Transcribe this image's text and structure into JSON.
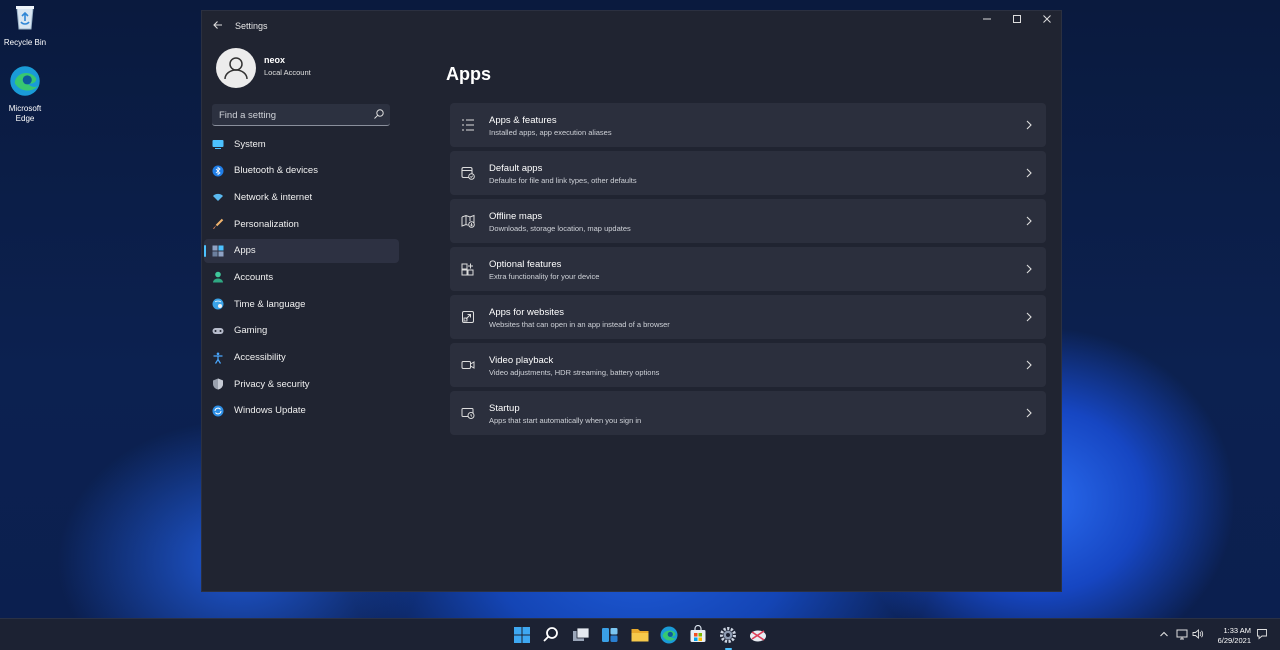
{
  "desktop": {
    "icons": [
      {
        "label": "Recycle Bin",
        "icon": "recycle-bin-icon"
      },
      {
        "label": "Microsoft Edge",
        "icon": "edge-icon"
      }
    ]
  },
  "window": {
    "title": "Settings",
    "controls": {
      "minimize": "minimize-icon",
      "maximize": "maximize-icon",
      "close": "close-icon"
    }
  },
  "profile": {
    "name": "neox",
    "account_type": "Local Account"
  },
  "search": {
    "placeholder": "Find a setting",
    "value": ""
  },
  "nav": {
    "items": [
      {
        "label": "System",
        "icon": "system-icon",
        "color": "#4cc2ff"
      },
      {
        "label": "Bluetooth & devices",
        "icon": "bluetooth-icon",
        "color": "#1f7ee8"
      },
      {
        "label": "Network & internet",
        "icon": "wifi-icon",
        "color": "#5ab9f0"
      },
      {
        "label": "Personalization",
        "icon": "brush-icon",
        "color": "#e6a35c"
      },
      {
        "label": "Apps",
        "icon": "apps-icon",
        "color": "#8fa2c4",
        "active": true
      },
      {
        "label": "Accounts",
        "icon": "accounts-icon",
        "color": "#3fc79b"
      },
      {
        "label": "Time & language",
        "icon": "time-language-icon",
        "color": "#3aa3e8"
      },
      {
        "label": "Gaming",
        "icon": "gaming-icon",
        "color": "#b7bccb"
      },
      {
        "label": "Accessibility",
        "icon": "accessibility-icon",
        "color": "#4aa8ff"
      },
      {
        "label": "Privacy & security",
        "icon": "shield-icon",
        "color": "#9aa1ae"
      },
      {
        "label": "Windows Update",
        "icon": "update-icon",
        "color": "#2d8fe6"
      }
    ]
  },
  "page": {
    "title": "Apps"
  },
  "cards": [
    {
      "title": "Apps & features",
      "subtitle": "Installed apps, app execution aliases",
      "icon": "apps-features-icon"
    },
    {
      "title": "Default apps",
      "subtitle": "Defaults for file and link types, other defaults",
      "icon": "default-apps-icon"
    },
    {
      "title": "Offline maps",
      "subtitle": "Downloads, storage location, map updates",
      "icon": "offline-maps-icon"
    },
    {
      "title": "Optional features",
      "subtitle": "Extra functionality for your device",
      "icon": "optional-features-icon"
    },
    {
      "title": "Apps for websites",
      "subtitle": "Websites that can open in an app instead of a browser",
      "icon": "apps-websites-icon"
    },
    {
      "title": "Video playback",
      "subtitle": "Video adjustments, HDR streaming, battery options",
      "icon": "video-playback-icon"
    },
    {
      "title": "Startup",
      "subtitle": "Apps that start automatically when you sign in",
      "icon": "startup-icon"
    }
  ],
  "taskbar": {
    "apps": [
      "start-icon",
      "search-icon",
      "task-view-icon",
      "widgets-icon",
      "file-explorer-icon",
      "edge-icon",
      "store-icon",
      "settings-icon",
      "snipping-tool-icon"
    ],
    "active_app": "settings-icon",
    "tray": [
      "chevron-up-icon",
      "network-icon",
      "volume-icon"
    ],
    "time": "1:33 AM",
    "date": "6/29/2021"
  }
}
